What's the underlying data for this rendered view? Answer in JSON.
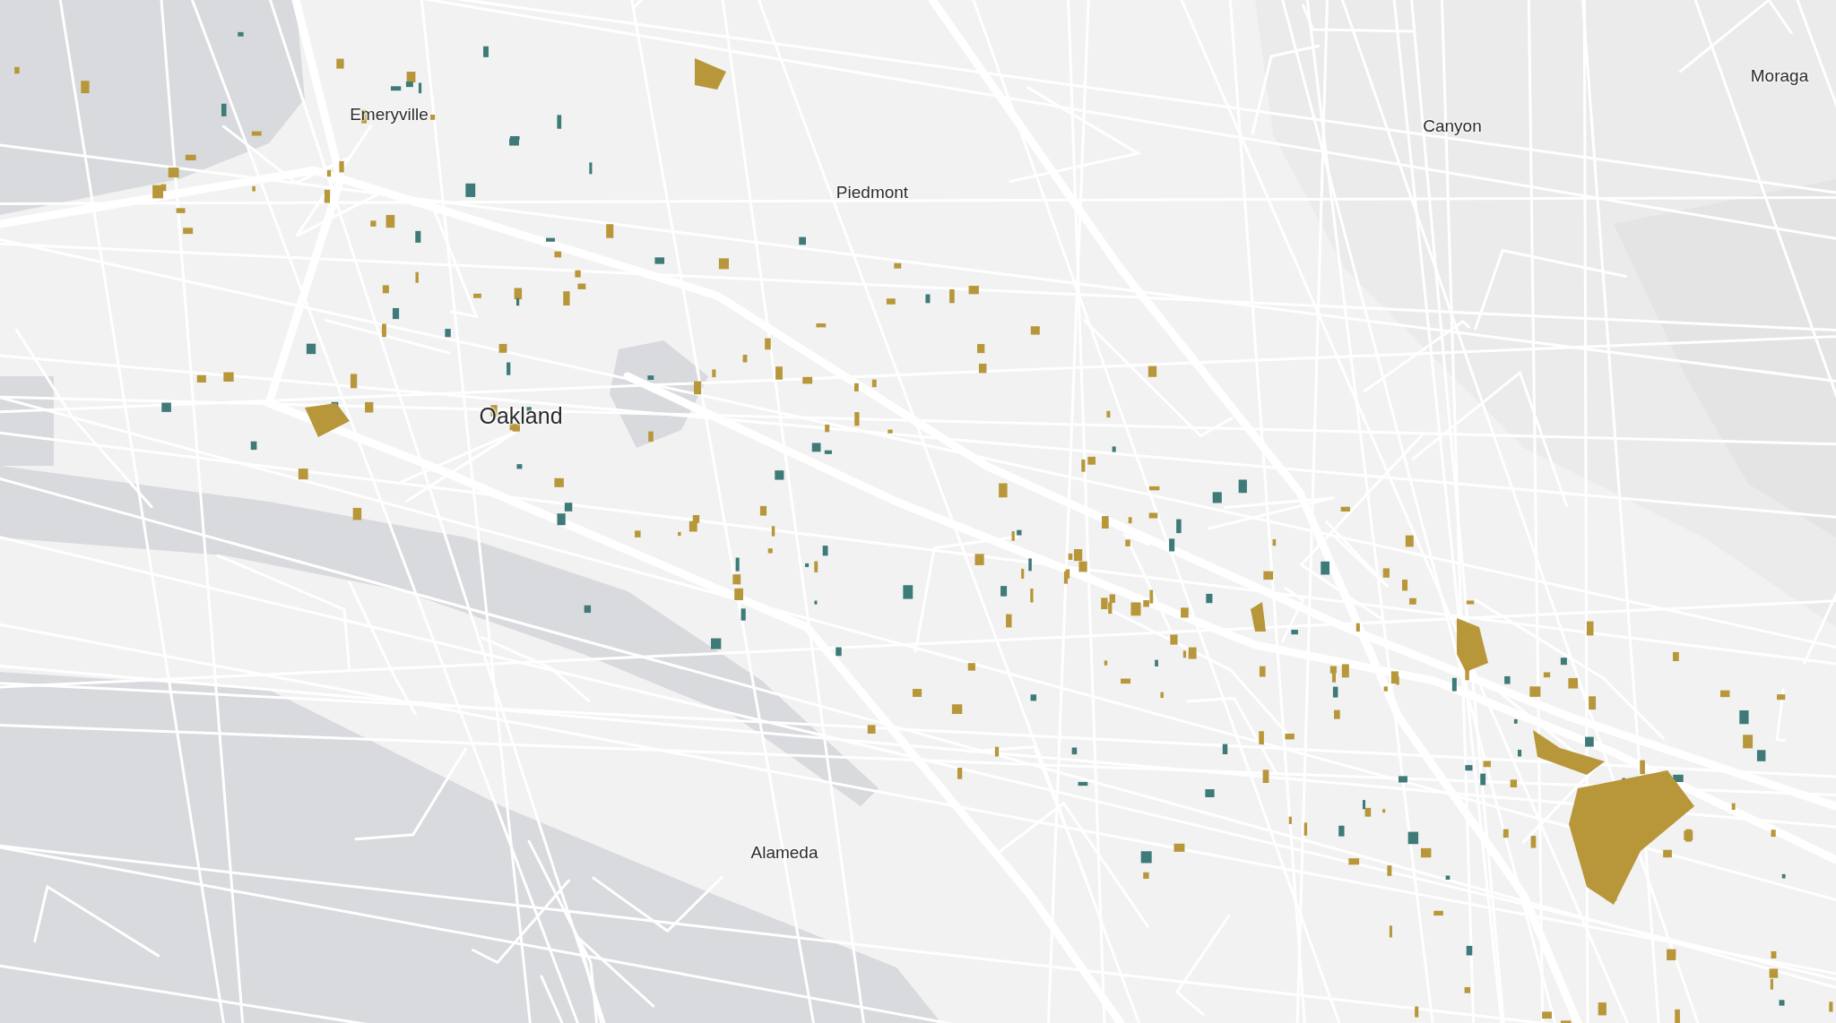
{
  "map": {
    "place_labels": [
      {
        "text": "Emeryville",
        "kind": "town"
      },
      {
        "text": "Piedmont",
        "kind": "town"
      },
      {
        "text": "Canyon",
        "kind": "town"
      },
      {
        "text": "Moraga",
        "kind": "town"
      },
      {
        "text": "Oakland",
        "kind": "city"
      },
      {
        "text": "Alameda",
        "kind": "town"
      }
    ]
  }
}
